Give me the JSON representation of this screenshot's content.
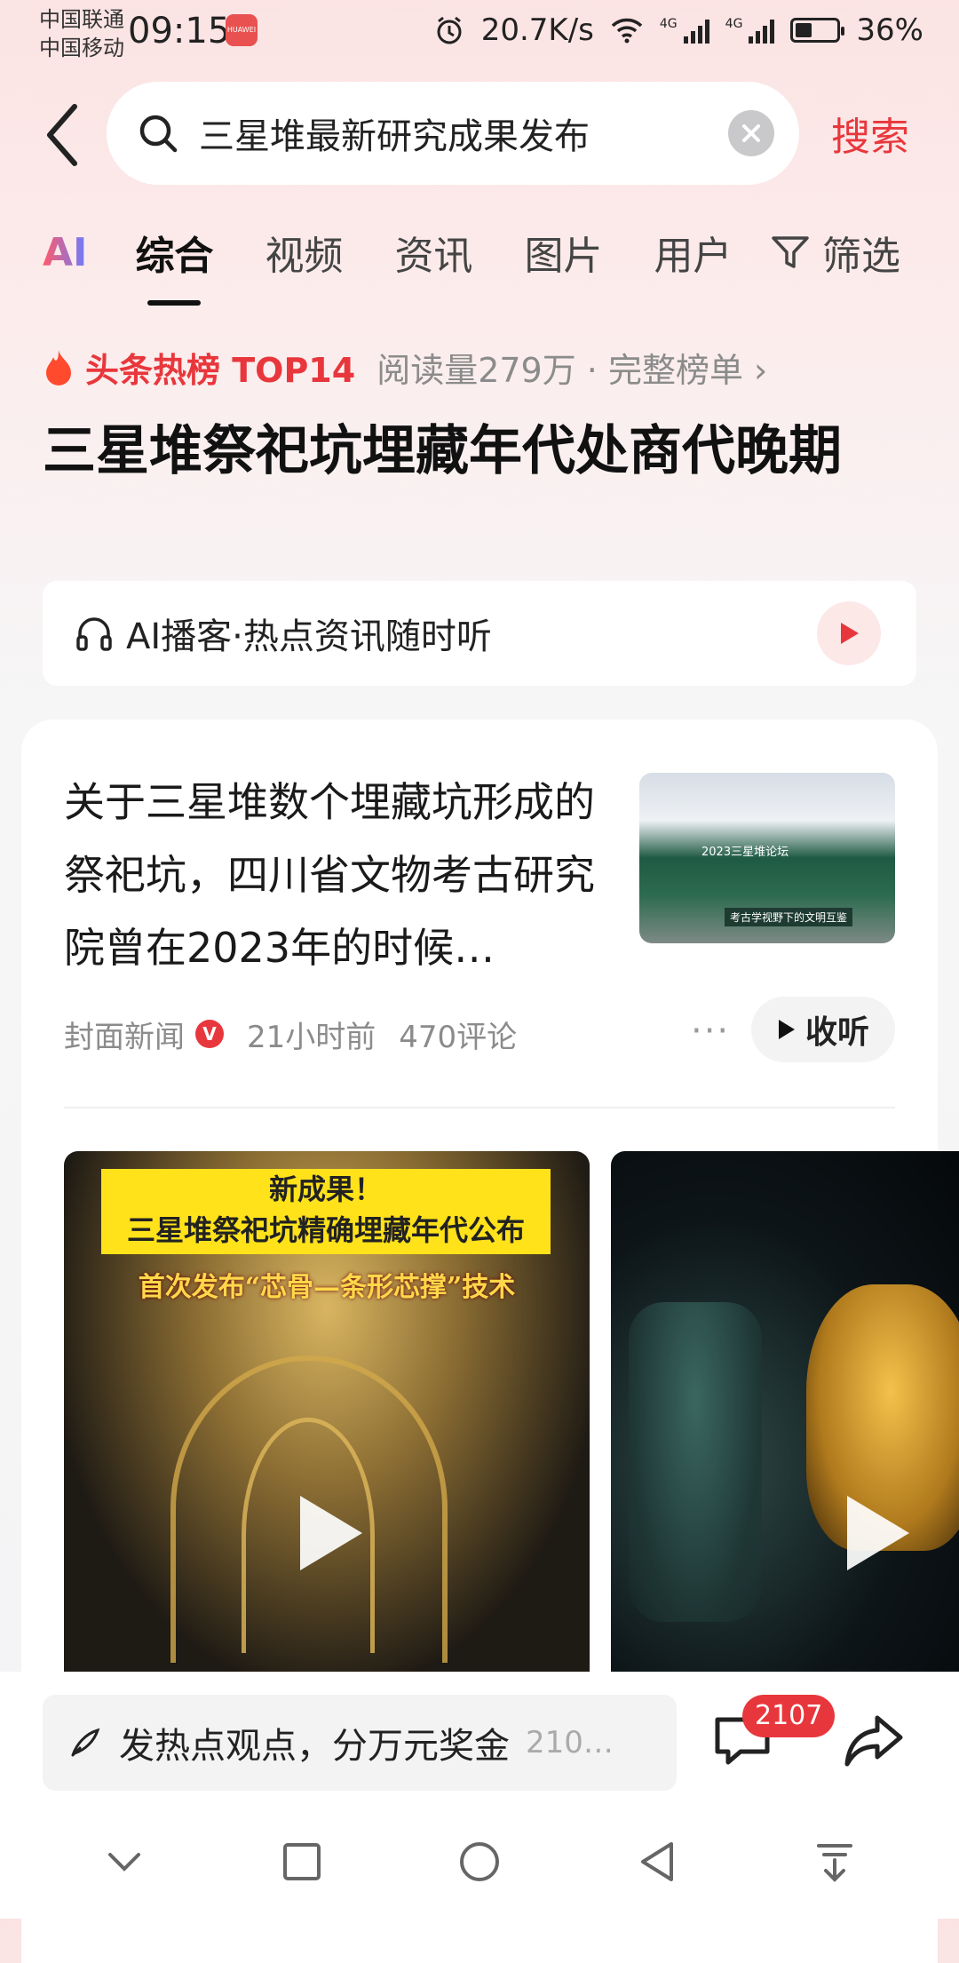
{
  "status_bar": {
    "carrier1": "中国联通",
    "carrier2": "中国移动",
    "time": "09:15",
    "app_badge": "HUAWEI",
    "net_speed": "20.7K/s",
    "sig1": "4G",
    "sig2": "4G",
    "battery": "36%",
    "battery_level": 0.36
  },
  "search": {
    "query": "三星堆最新研究成果发布",
    "button": "搜索"
  },
  "tabs": [
    "AI",
    "综合",
    "视频",
    "资讯",
    "图片",
    "用户"
  ],
  "filter_label": "筛选",
  "hot_rank": {
    "title": "头条热榜 TOP14",
    "meta": "阅读量279万 · 完整榜单 ›"
  },
  "headline": "三星堆祭祀坑埋藏年代处商代晚期",
  "podcast": {
    "label": "AI播客·热点资讯随时听"
  },
  "article": {
    "text": "关于三星堆数个埋藏坑形成的祭祀坑，四川省文物考古研究院曾在2023年的时候…",
    "source": "封面新闻",
    "verified": "V",
    "time": "21小时前",
    "comments": "470评论",
    "more": "···",
    "listen": "收听",
    "thumb_title": "2023三星堆论坛",
    "thumb_sub": "考古学视野下的文明互鉴"
  },
  "video1": {
    "banner_line1": "新成果！",
    "banner_line2": "三星堆祭祀坑精确埋藏年代公布",
    "subtitle": "首次发布“芯骨—条形芯撑”技术"
  },
  "comment_bar": {
    "placeholder": "发热点观点，分万元奖金",
    "count_preview": "210…",
    "badge": "2107"
  },
  "colors": {
    "accent": "#e8373c",
    "text": "#222222",
    "muted": "#8b8b8b"
  }
}
